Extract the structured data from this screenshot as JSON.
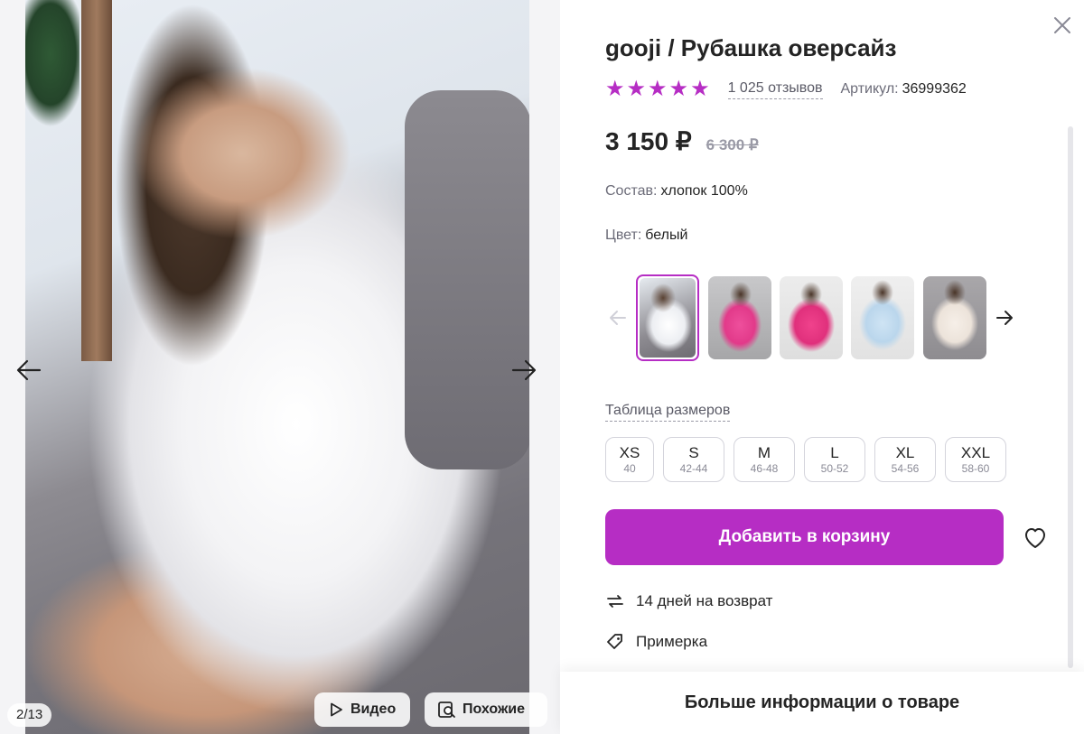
{
  "gallery": {
    "counter": "2/13",
    "video_label": "Видео",
    "similar_label": "Похожие"
  },
  "product": {
    "title": "gooji / Рубашка оверсайз",
    "stars": "★★★★★",
    "reviews": "1 025 отзывов",
    "article_label": "Артикул:",
    "article_value": "36999362",
    "price": "3 150 ₽",
    "old_price": "6 300 ₽",
    "composition_label": "Состав:",
    "composition_value": "хлопок 100%",
    "color_label": "Цвет:",
    "color_value": "белый",
    "size_table_link": "Таблица размеров",
    "sizes": [
      {
        "size": "XS",
        "ru": "40"
      },
      {
        "size": "S",
        "ru": "42-44"
      },
      {
        "size": "M",
        "ru": "46-48"
      },
      {
        "size": "L",
        "ru": "50-52"
      },
      {
        "size": "XL",
        "ru": "54-56"
      },
      {
        "size": "XXL",
        "ru": "58-60"
      }
    ],
    "add_to_cart": "Добавить в корзину",
    "features": [
      {
        "icon": "return-arrows-icon",
        "text": "14 дней на возврат"
      },
      {
        "icon": "tag-icon",
        "text": "Примерка"
      }
    ],
    "more_info": "Больше информации о товаре"
  },
  "colors": {
    "accent": "#b62dc4",
    "text": "#242424",
    "muted": "#6b6b78",
    "old_price": "#9a9aa6"
  }
}
